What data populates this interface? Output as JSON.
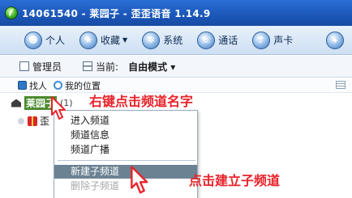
{
  "window": {
    "title": "14061540 - 莱园子 - 歪歪语音 1.14.9"
  },
  "toolbar": {
    "items": [
      {
        "label": "个人",
        "icon": "person-icon",
        "caret": false
      },
      {
        "label": "收藏",
        "icon": "star-icon",
        "caret": true
      },
      {
        "label": "系统",
        "icon": "gear-icon",
        "caret": false
      },
      {
        "label": "通话",
        "icon": "phone-icon",
        "caret": false
      },
      {
        "label": "声卡",
        "icon": "speaker-icon",
        "caret": false
      }
    ]
  },
  "modebar": {
    "admin_label": "管理员",
    "current_label": "当前:",
    "mode_value": "自由模式",
    "mode_caret": "▾"
  },
  "pane": {
    "find_label": "找人",
    "my_location_label": "我的位置",
    "channel_name": "莱园子",
    "channel_count": "(1)",
    "user_name": "歪"
  },
  "context_menu": {
    "items": [
      {
        "label": "进入频道",
        "state": "normal"
      },
      {
        "label": "频道信息",
        "state": "normal"
      },
      {
        "label": "频道广播",
        "state": "normal"
      },
      {
        "label": "新建子频道",
        "state": "selected"
      },
      {
        "label": "删除子频道",
        "state": "disabled"
      }
    ]
  },
  "annotations": {
    "right_click_hint": "右键点击频道名字",
    "create_hint": "点击建立子频道",
    "color": "#e8232a"
  }
}
